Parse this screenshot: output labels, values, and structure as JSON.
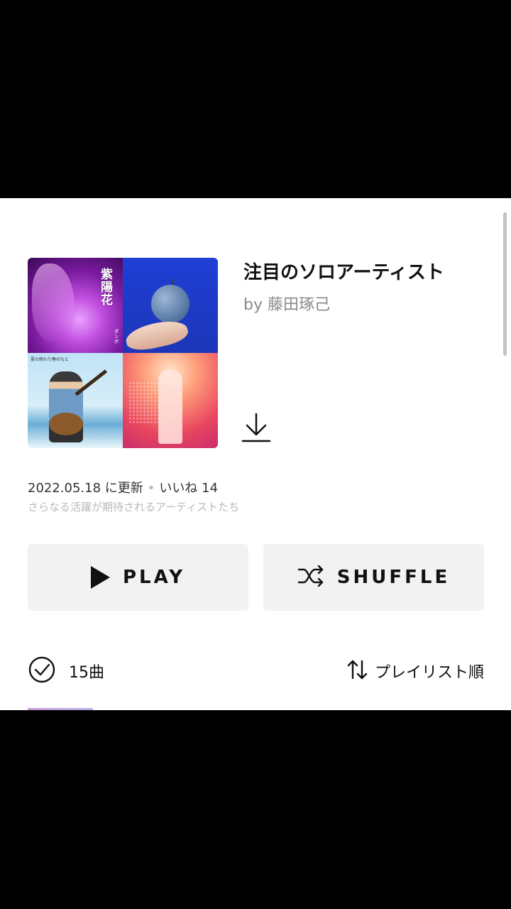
{
  "playlist": {
    "title": "注目のソロアーティスト",
    "author": "by 藤田琢己",
    "updated": "2022.05.18 に更新",
    "separator": "•",
    "likes": "いいね 14",
    "description": "さらなる活躍が期待されるアーティストたち",
    "cover_tiles": [
      {
        "text": "紫陽花",
        "subtext": "ダンボ"
      },
      {
        "text": ""
      },
      {
        "text": "夏の終わり春のもと"
      },
      {
        "text": ""
      }
    ]
  },
  "actions": {
    "play_label": "PLAY",
    "shuffle_label": "SHUFFLE"
  },
  "tracklist": {
    "count": "15曲",
    "sort_label": "プレイリスト順"
  },
  "icons": {
    "download": "download-icon",
    "play": "play-icon",
    "shuffle": "shuffle-icon",
    "check": "check-circle-icon",
    "sort": "sort-icon"
  },
  "colors": {
    "background": "#000000",
    "panel": "#ffffff",
    "button_bg": "#f2f2f2",
    "text": "#111111",
    "muted": "#8a8a8a"
  }
}
